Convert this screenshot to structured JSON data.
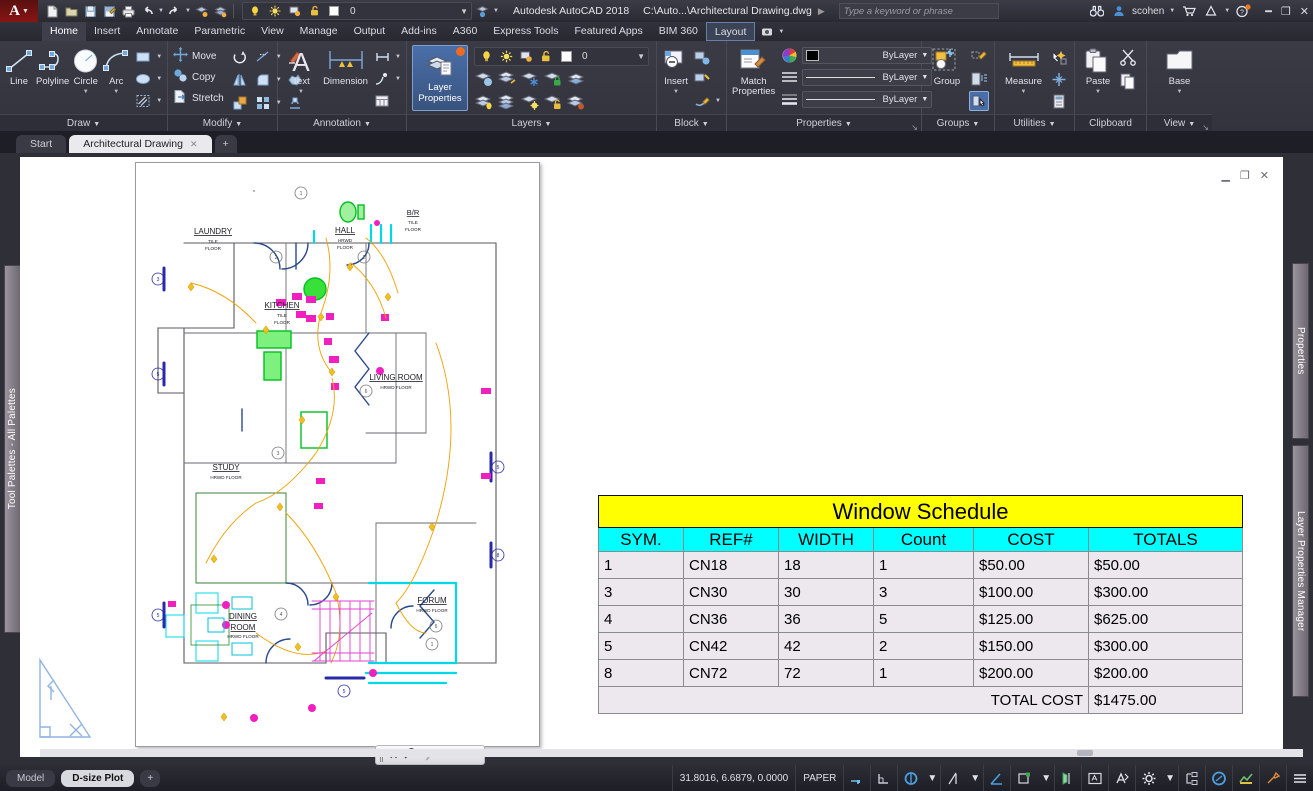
{
  "titlebar": {
    "logo": "A",
    "app_title": "Autodesk AutoCAD 2018",
    "file_path": "C:\\Auto...\\Architectural Drawing.dwg",
    "search_placeholder": "Type a keyword or phrase",
    "user": "scohen",
    "layer_value": "0",
    "quick_access_icons": [
      "new-icon",
      "open-icon",
      "save-icon",
      "saveas-icon",
      "plot-icon",
      "undo-icon",
      "redo-icon",
      "layer-previous-icon",
      "layer-state-icon"
    ],
    "window_buttons": [
      "minimize",
      "restore",
      "close"
    ]
  },
  "ribbon_tabs": [
    {
      "label": "Home",
      "active": true
    },
    {
      "label": "Insert",
      "active": false
    },
    {
      "label": "Annotate",
      "active": false
    },
    {
      "label": "Parametric",
      "active": false
    },
    {
      "label": "View",
      "active": false
    },
    {
      "label": "Manage",
      "active": false
    },
    {
      "label": "Output",
      "active": false
    },
    {
      "label": "Add-ins",
      "active": false
    },
    {
      "label": "A360",
      "active": false
    },
    {
      "label": "Express Tools",
      "active": false
    },
    {
      "label": "Featured Apps",
      "active": false
    },
    {
      "label": "BIM 360",
      "active": false
    },
    {
      "label": "Layout",
      "active": false,
      "boxed": true
    }
  ],
  "ribbon_panels": [
    {
      "name": "Draw",
      "label": "Draw",
      "big_buttons": [
        {
          "label": "Line",
          "icon": "line-icon"
        },
        {
          "label": "Polyline",
          "icon": "polyline-icon"
        },
        {
          "label": "Circle",
          "icon": "circle-icon",
          "has_arrow": true
        },
        {
          "label": "Arc",
          "icon": "arc-icon",
          "has_arrow": true
        }
      ],
      "small_buttons": [
        "rectangle-icon",
        "ellipse-icon",
        "hatch-icon"
      ]
    },
    {
      "name": "Modify",
      "label": "Modify",
      "text_buttons": [
        "Move",
        "Copy",
        "Stretch"
      ],
      "small_buttons": [
        "rotate-icon",
        "trim-icon",
        "mirror-icon",
        "fillet-icon",
        "array-icon",
        "scale-icon",
        "explode-icon",
        "erase-icon"
      ]
    },
    {
      "name": "Annotation",
      "label": "Annotation",
      "big_buttons": [
        {
          "label": "Text",
          "icon": "text-icon",
          "has_arrow": true
        },
        {
          "label": "Dimension",
          "icon": "dimension-icon"
        }
      ],
      "small_buttons": [
        "dim-style-icon",
        "leader-icon",
        "table-icon"
      ]
    },
    {
      "name": "Layers",
      "label": "Layers",
      "main_button": "Layer Properties",
      "layer_value": "0",
      "small_buttons": [
        "layer-off-icon",
        "layer-isolate-icon",
        "layer-freeze-icon",
        "layer-lock-icon",
        "layer-merge-icon",
        "layer-on-icon",
        "layer-unisolate-icon",
        "layer-thaw-icon",
        "layer-unlock-icon",
        "layer-delete-icon"
      ]
    },
    {
      "name": "Block",
      "label": "Block",
      "big_buttons": [
        {
          "label": "Insert",
          "icon": "insert-block-icon",
          "has_arrow": true
        }
      ],
      "small_buttons": [
        "create-block-icon",
        "edit-attributes-icon",
        "block-editor-icon"
      ]
    },
    {
      "name": "Properties",
      "label": "Properties",
      "big_buttons": [
        {
          "label": "Match Properties",
          "icon": "match-properties-icon"
        }
      ],
      "combos": [
        {
          "name": "color-combo",
          "value": "ByLayer",
          "icon": "color-wheel-icon"
        },
        {
          "name": "linetype-combo",
          "value": "ByLayer",
          "icon": "linetype-icon"
        },
        {
          "name": "lineweight-combo",
          "value": "ByLayer",
          "icon": "lineweight-icon"
        }
      ]
    },
    {
      "name": "Groups",
      "label": "Groups",
      "big_buttons": [
        {
          "label": "Group",
          "icon": "group-icon"
        }
      ],
      "small_buttons": [
        "edit-group-icon",
        "ungroup-icon",
        "group-selection-icon"
      ]
    },
    {
      "name": "Utilities",
      "label": "Utilities",
      "big_buttons": [
        {
          "label": "Measure",
          "icon": "measure-icon",
          "has_arrow": true
        }
      ],
      "small_buttons": [
        "quick-select-icon",
        "point-icon",
        "calculator-icon"
      ]
    },
    {
      "name": "Clipboard",
      "label": "Clipboard",
      "big_buttons": [
        {
          "label": "Paste",
          "icon": "paste-icon",
          "has_arrow": true
        }
      ],
      "small_buttons": [
        "cut-icon",
        "copy-clip-icon"
      ]
    },
    {
      "name": "View",
      "label": "View",
      "big_buttons": [
        {
          "label": "Base",
          "icon": "base-view-icon",
          "has_arrow": true
        }
      ]
    }
  ],
  "doc_tabs": [
    {
      "label": "Start",
      "active": false,
      "closable": false
    },
    {
      "label": "Architectural Drawing",
      "active": true,
      "closable": true
    },
    {
      "label": "+",
      "active": false,
      "closable": false
    }
  ],
  "panels": {
    "left": "Tool Palettes - All Palettes",
    "right_top": "Properties",
    "right_bottom": "Layer Properties Manager"
  },
  "drawing": {
    "rooms": [
      {
        "name": "LAUNDRY",
        "floor": "TILE FLOOR"
      },
      {
        "name": "KITCHEN",
        "floor": "TILE FLOOR"
      },
      {
        "name": "HALL",
        "floor": "HRWD FLOOR"
      },
      {
        "name": "B/R",
        "floor": "TILE FLOOR"
      },
      {
        "name": "LIVING ROOM",
        "floor": "HRWD FLOOR"
      },
      {
        "name": "STUDY",
        "floor": "HRWD FLOOR"
      },
      {
        "name": "DINING ROOM",
        "floor": "HRWD FLOOR"
      },
      {
        "name": "FORUM",
        "floor": "HRWD FLOOR"
      }
    ],
    "window_tags": [
      "1",
      "2",
      "2",
      "6",
      "3",
      "4",
      "5",
      "8",
      "1",
      "3",
      "6",
      "5"
    ],
    "viewport_toolbar": [
      "close-icon",
      "wrench-icon"
    ]
  },
  "window_schedule": {
    "title": "Window Schedule",
    "columns": [
      "SYM.",
      "REF#",
      "WIDTH",
      "Count",
      "COST",
      "TOTALS"
    ],
    "rows": [
      [
        "1",
        "CN18",
        "18",
        "1",
        "$50.00",
        "$50.00"
      ],
      [
        "3",
        "CN30",
        "30",
        "3",
        "$100.00",
        "$300.00"
      ],
      [
        "4",
        "CN36",
        "36",
        "5",
        "$125.00",
        "$625.00"
      ],
      [
        "5",
        "CN42",
        "42",
        "2",
        "$150.00",
        "$300.00"
      ],
      [
        "8",
        "CN72",
        "72",
        "1",
        "$200.00",
        "$200.00"
      ]
    ],
    "total_label": "TOTAL COST",
    "total_value": "$1475.00",
    "colors": {
      "title_bg": "#ffff00",
      "header_bg": "#00ffff",
      "cell_bg": "#ece8ee"
    }
  },
  "statusbar": {
    "layout_tabs": [
      {
        "label": "Model",
        "active": false
      },
      {
        "label": "D-size Plot",
        "active": true
      },
      {
        "label": "+",
        "active": false
      }
    ],
    "coordinates": "31.8016, 6.6879, 0.0000",
    "space": "PAPER",
    "icons": [
      "infer-constraints-icon",
      "snap-grid-icon",
      "ortho-icon",
      "polar-tracking-icon",
      "osnap-icon",
      "otrack-icon",
      "lineweight-icon",
      "annotation-visibility-icon",
      "annotation-scale-icon",
      "workspace-icon",
      "customization-icon",
      "isolate-objects-icon",
      "hardware-accel-icon",
      "clean-screen-icon",
      "menu-icon"
    ]
  }
}
